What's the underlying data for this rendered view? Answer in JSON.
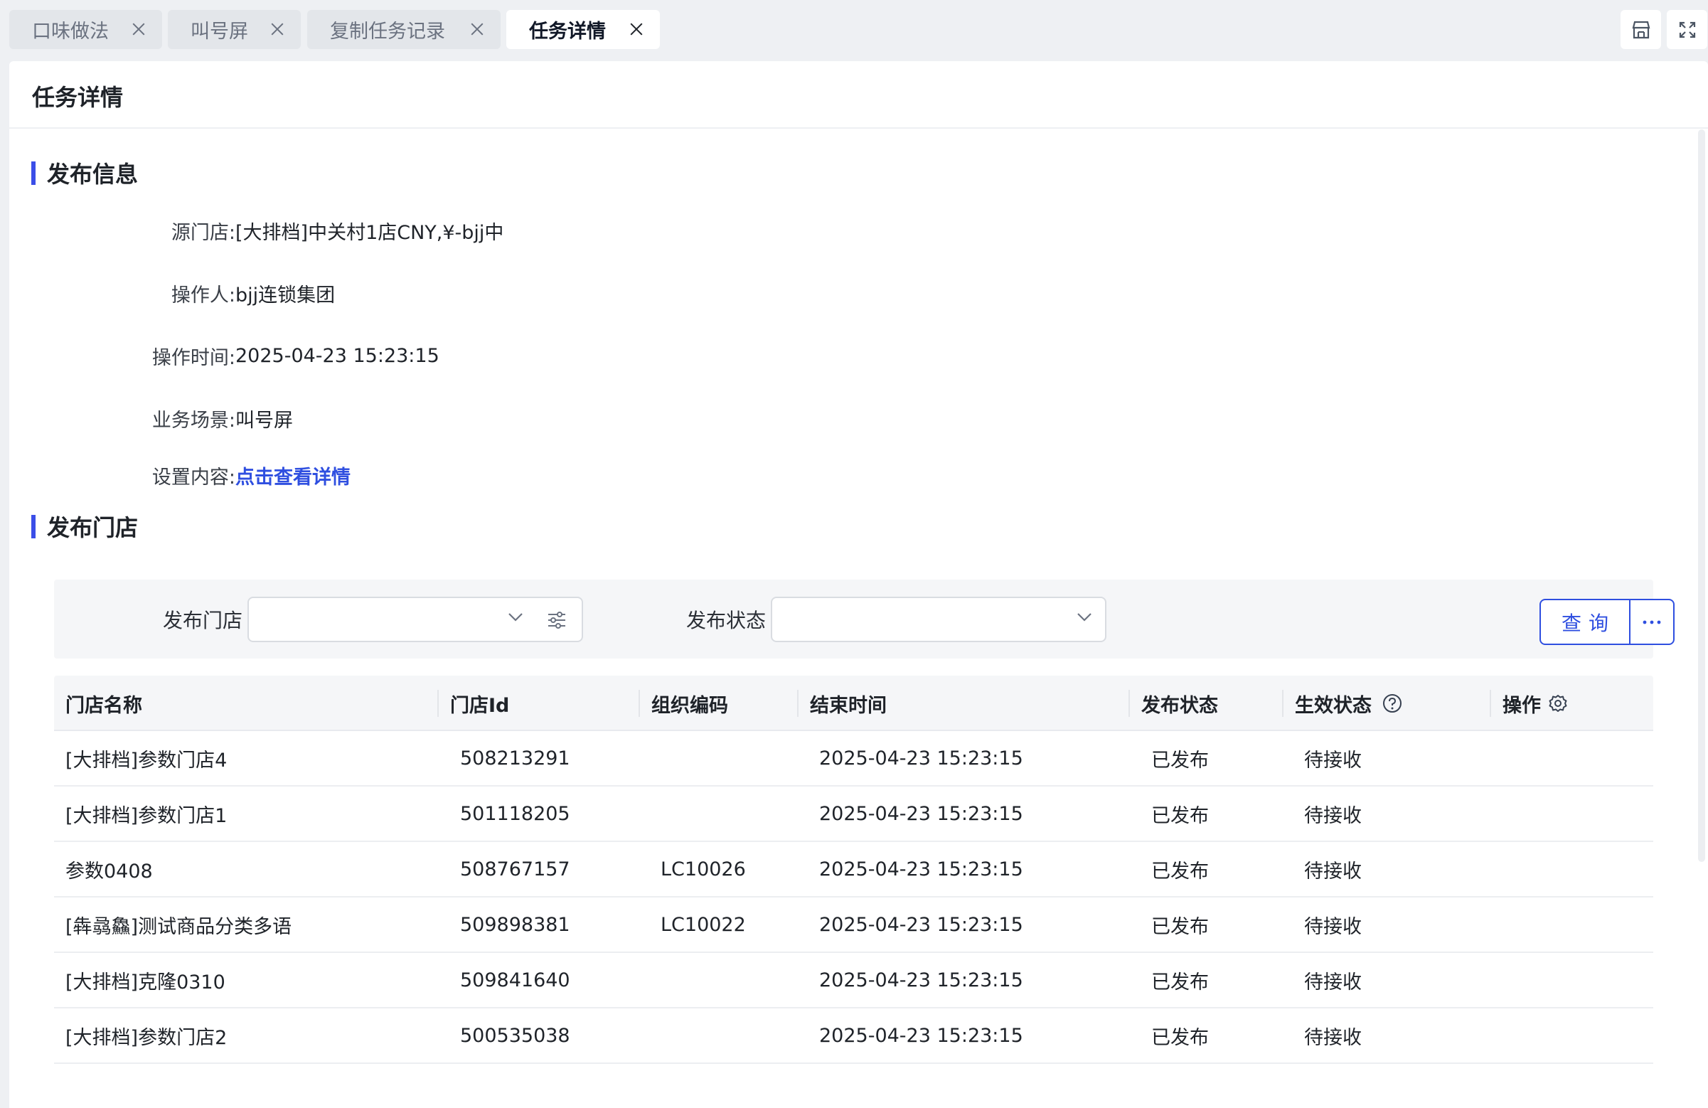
{
  "tabs": [
    {
      "label": "口味做法",
      "active": false
    },
    {
      "label": "叫号屏",
      "active": false
    },
    {
      "label": "复制任务记录",
      "active": false
    },
    {
      "label": "任务详情",
      "active": true
    }
  ],
  "toolbar": {
    "icons": [
      "shop-icon",
      "fullscreen-icon"
    ]
  },
  "page": {
    "title": "任务详情"
  },
  "publish_info": {
    "section_title": "发布信息",
    "rows": [
      {
        "label": "源门店:",
        "value": "[大排档]中关村1店CNY,¥-bjj中"
      },
      {
        "label": "操作人:",
        "value": "bjj连锁集团"
      },
      {
        "label": "操作时间:",
        "value": "2025-04-23 15:23:15"
      },
      {
        "label": "业务场景:",
        "value": "叫号屏"
      }
    ],
    "settings": {
      "label": "设置内容:",
      "link_text": "点击查看详情"
    }
  },
  "publish_stores": {
    "section_title": "发布门店",
    "filter": {
      "store_label": "发布门店",
      "store_value": "",
      "status_label": "发布状态",
      "status_value": "",
      "query_button": "查询",
      "more_button_icon": "ellipsis-icon"
    },
    "columns": [
      "门店名称",
      "门店Id",
      "组织编码",
      "结束时间",
      "发布状态",
      "生效状态",
      "操作"
    ],
    "rows": [
      {
        "name": "[大排档]参数门店4",
        "id": "508213291",
        "org": "",
        "end": "2025-04-23 15:23:15",
        "pub": "已发布",
        "eff": "待接收"
      },
      {
        "name": "[大排档]参数门店1",
        "id": "501118205",
        "org": "",
        "end": "2025-04-23 15:23:15",
        "pub": "已发布",
        "eff": "待接收"
      },
      {
        "name": "参数0408",
        "id": "508767157",
        "org": "LC10026",
        "end": "2025-04-23 15:23:15",
        "pub": "已发布",
        "eff": "待接收"
      },
      {
        "name": "[犇骉鱻]测试商品分类多语",
        "id": "509898381",
        "org": "LC10022",
        "end": "2025-04-23 15:23:15",
        "pub": "已发布",
        "eff": "待接收"
      },
      {
        "name": "[大排档]克隆0310",
        "id": "509841640",
        "org": "",
        "end": "2025-04-23 15:23:15",
        "pub": "已发布",
        "eff": "待接收"
      },
      {
        "name": "[大排档]参数门店2",
        "id": "500535038",
        "org": "",
        "end": "2025-04-23 15:23:15",
        "pub": "已发布",
        "eff": "待接收"
      }
    ]
  },
  "colors": {
    "accent": "#2f4fe0",
    "section_bar": "#3b4ee8",
    "background": "#eef0f3"
  }
}
